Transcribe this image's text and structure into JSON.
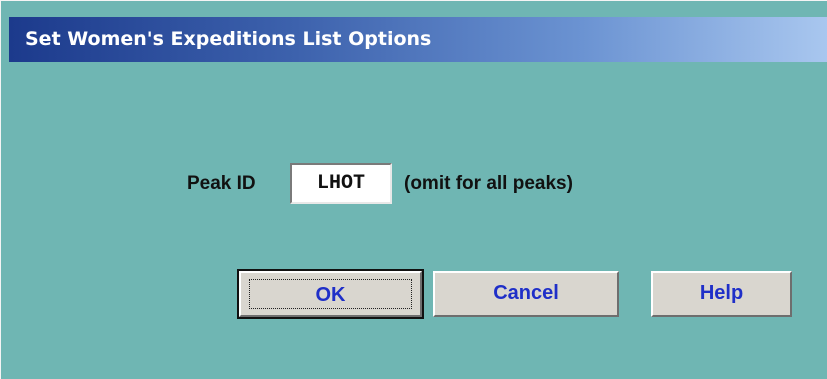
{
  "dialog": {
    "title": "Set Women's Expeditions List Options"
  },
  "form": {
    "peak_id_label": "Peak ID",
    "peak_id_value": "LHOT",
    "hint": "(omit for all peaks)"
  },
  "buttons": {
    "ok": "OK",
    "cancel": "Cancel",
    "help": "Help"
  },
  "colors": {
    "dialog_background": "#6fb6b3",
    "titlebar_start": "#1c3a8c",
    "titlebar_end": "#a9c7ef",
    "button_face": "#d9d6cf",
    "button_text": "#1f2fc8"
  }
}
